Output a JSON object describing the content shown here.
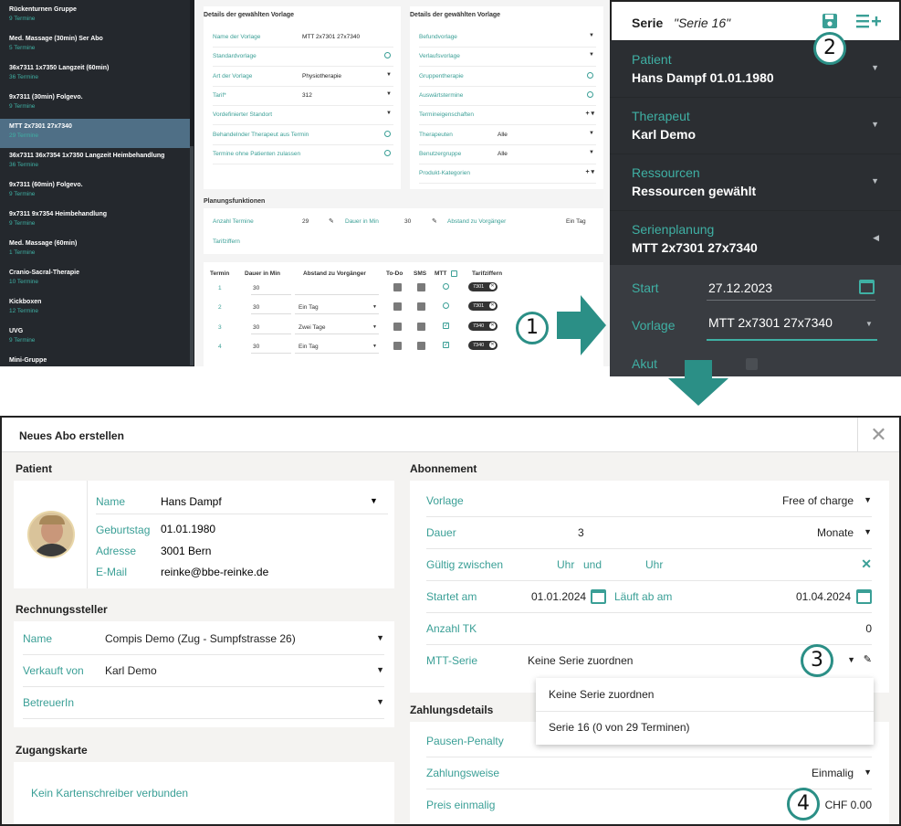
{
  "template_list": {
    "items": [
      {
        "name": "Rückenturnen Gruppe",
        "count": "9 Termine"
      },
      {
        "name": "Med. Massage (30min) Ser Abo",
        "count": "5 Termine"
      },
      {
        "name": "36x7311 1x7350 Langzeit (60min)",
        "count": "36 Termine"
      },
      {
        "name": "9x7311 (30min) Folgevo.",
        "count": "9 Termine"
      },
      {
        "name": "MTT 2x7301 27x7340",
        "count": "29 Termine"
      },
      {
        "name": "36x7311 36x7354 1x7350 Langzeit Heimbehandlung",
        "count": "36 Termine"
      },
      {
        "name": "9x7311 (60min) Folgevo.",
        "count": "9 Termine"
      },
      {
        "name": "9x7311 9x7354 Heimbehandlung",
        "count": "9 Termine"
      },
      {
        "name": "Med. Massage (60min)",
        "count": "1 Termine"
      },
      {
        "name": "Cranio-Sacral-Therapie",
        "count": "10 Termine"
      },
      {
        "name": "Kickboxen",
        "count": "12 Termine"
      },
      {
        "name": "UVG",
        "count": "9 Termine"
      },
      {
        "name": "Mini-Gruppe",
        "count": ""
      }
    ]
  },
  "details": {
    "left_title": "Details der gewählten Vorlage",
    "right_title": "Details der gewählten Vorlage",
    "left_fields": [
      {
        "label": "Name der Vorlage",
        "value": "MTT 2x7301 27x7340"
      },
      {
        "label": "Standardvorlage",
        "value": ""
      },
      {
        "label": "Art der Vorlage",
        "value": "Physiotherapie"
      },
      {
        "label": "Tarif*",
        "value": "312"
      },
      {
        "label": "Vordefinierter Standort",
        "value": ""
      },
      {
        "label": "Behandelnder Therapeut aus Termin",
        "value": ""
      },
      {
        "label": "Termine ohne Patienten zulassen",
        "value": ""
      }
    ],
    "right_fields": [
      {
        "label": "Befundvorlage",
        "value": ""
      },
      {
        "label": "Verlaufsvorlage",
        "value": ""
      },
      {
        "label": "Gruppentherapie",
        "value": ""
      },
      {
        "label": "Auswärtstermine",
        "value": ""
      },
      {
        "label": "Termineigenschaften",
        "value": ""
      },
      {
        "label": "Therapeuten",
        "value": "Alle"
      },
      {
        "label": "Benutzergruppe",
        "value": "Alle"
      },
      {
        "label": "Produkt-Kategorien",
        "value": ""
      }
    ],
    "planning_title": "Planungsfunktionen",
    "planning": {
      "anzahl_label": "Anzahl Termine",
      "anzahl_value": "29",
      "dauer_label": "Dauer in Min",
      "dauer_value": "30",
      "abstand_label": "Abstand zu Vorgänger",
      "abstand_value": "Ein Tag",
      "tarif_label": "Tarifziffern"
    },
    "table_headers": [
      "Termin",
      "Dauer in Min",
      "Abstand zu Vorgänger",
      "To-Do",
      "SMS",
      "MTT",
      "Tarifziffern"
    ],
    "rows": [
      {
        "nr": "1",
        "dauer": "30",
        "abstand": "",
        "mtt": false,
        "tag": "7301"
      },
      {
        "nr": "2",
        "dauer": "30",
        "abstand": "Ein Tag",
        "mtt": false,
        "tag": "7301"
      },
      {
        "nr": "3",
        "dauer": "30",
        "abstand": "Zwei Tage",
        "mtt": true,
        "tag": "7340"
      },
      {
        "nr": "4",
        "dauer": "30",
        "abstand": "Ein Tag",
        "mtt": true,
        "tag": "7340"
      }
    ]
  },
  "serie": {
    "title": "Serie",
    "name": "\"Serie 16\"",
    "sections": [
      {
        "label": "Patient",
        "value": "Hans Dampf 01.01.1980"
      },
      {
        "label": "Therapeut",
        "value": "Karl Demo"
      },
      {
        "label": "Ressourcen",
        "value": "Ressourcen gewählt"
      },
      {
        "label": "Serienplanung",
        "value": "MTT 2x7301 27x7340"
      }
    ],
    "start_label": "Start",
    "start_value": "27.12.2023",
    "vorlage_label": "Vorlage",
    "vorlage_value": "MTT 2x7301 27x7340",
    "akut_label": "Akut"
  },
  "callouts": [
    "1",
    "2",
    "3",
    "4"
  ],
  "modal": {
    "title": "Neues Abo erstellen",
    "patient_section": "Patient",
    "patient": {
      "name_label": "Name",
      "name_value": "Hans Dampf",
      "birth_label": "Geburtstag",
      "birth_value": "01.01.1980",
      "address_label": "Adresse",
      "address_value": "3001 Bern",
      "email_label": "E-Mail",
      "email_value": "reinke@bbe-reinke.de"
    },
    "biller_section": "Rechnungssteller",
    "biller": {
      "name_label": "Name",
      "name_value": "Compis Demo (Zug - Sumpfstrasse 26)",
      "sold_label": "Verkauft von",
      "sold_value": "Karl Demo",
      "caretaker_label": "BetreuerIn",
      "caretaker_value": ""
    },
    "card_section": "Zugangskarte",
    "card_message": "Kein Kartenschreiber verbunden",
    "abo_section": "Abonnement",
    "abo": {
      "vorlage_label": "Vorlage",
      "vorlage_value": "Free of charge",
      "dauer_label": "Dauer",
      "dauer_value": "3",
      "dauer_unit": "Monate",
      "gueltig_label": "Gültig zwischen",
      "uhr1": "Uhr",
      "und": "und",
      "uhr2": "Uhr",
      "start_label": "Startet am",
      "start_value": "01.01.2024",
      "end_label": "Läuft ab am",
      "end_value": "01.04.2024",
      "tk_label": "Anzahl TK",
      "tk_value": "0",
      "mtt_label": "MTT-Serie",
      "mtt_value": "Keine Serie zuordnen"
    },
    "dropdown_options": [
      "Keine Serie zuordnen",
      "Serie 16 (0 von 29 Terminen)"
    ],
    "payment_section": "Zahlungsdetails",
    "payment": {
      "pause_label": "Pausen-Penalty",
      "method_label": "Zahlungsweise",
      "method_value": "Einmalig",
      "price_label": "Preis einmalig",
      "price_value": "CHF 0.00"
    }
  }
}
